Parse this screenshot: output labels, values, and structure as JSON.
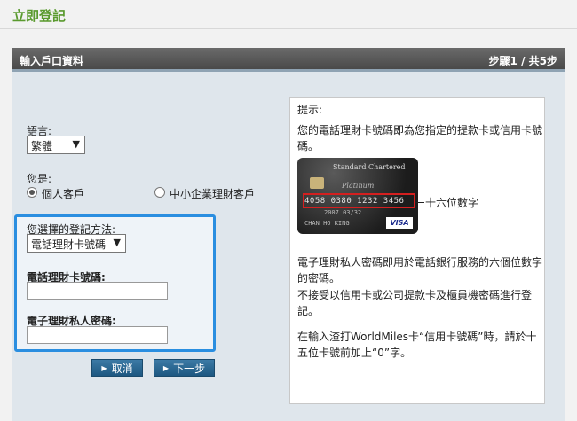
{
  "page": {
    "title": "立即登記"
  },
  "panel": {
    "title": "輸入戶口資料",
    "step_text": "步驟1 / 共5步"
  },
  "form": {
    "language_label": "語言:",
    "language_value": "繁體",
    "you_are_label": "您是:",
    "customer_types": [
      {
        "label": "個人客戶",
        "selected": true
      },
      {
        "label": "中小企業理財客戶",
        "selected": false
      }
    ],
    "method_label": "您選擇的登記方法:",
    "method_value": "電話理財卡號碼",
    "phone_card_label": "電話理財卡號碼:",
    "phone_card_value": "",
    "pin_label": "電子理財私人密碼:",
    "pin_value": ""
  },
  "buttons": {
    "cancel": "取消",
    "next": "下一步"
  },
  "tips": {
    "heading": "提示:",
    "p1": "您的電話理財卡號碼即為您指定的提款卡或信用卡號碼。",
    "card_callout": "十六位數字",
    "p2": "電子理財私人密碼即用於電話銀行服務的六個位數字的密碼。",
    "p3": "不接受以信用卡或公司提款卡及櫃員機密碼進行登記。",
    "p4": "在輸入渣打WorldMiles卡“信用卡號碼”時，請於十五位卡號前加上“0”字。"
  },
  "card_image": {
    "brand": "Standard Chartered",
    "tier": "Platinum",
    "number": "4058 0380 1232 3456",
    "expiry": "2007   03/32",
    "holder": "CHAN HO KING",
    "network": "VISA"
  },
  "colors": {
    "title_green": "#5a9a2e",
    "highlight_blue": "#2a8ee0",
    "button_blue": "#1d5781",
    "callout_red": "#d41f1f"
  }
}
